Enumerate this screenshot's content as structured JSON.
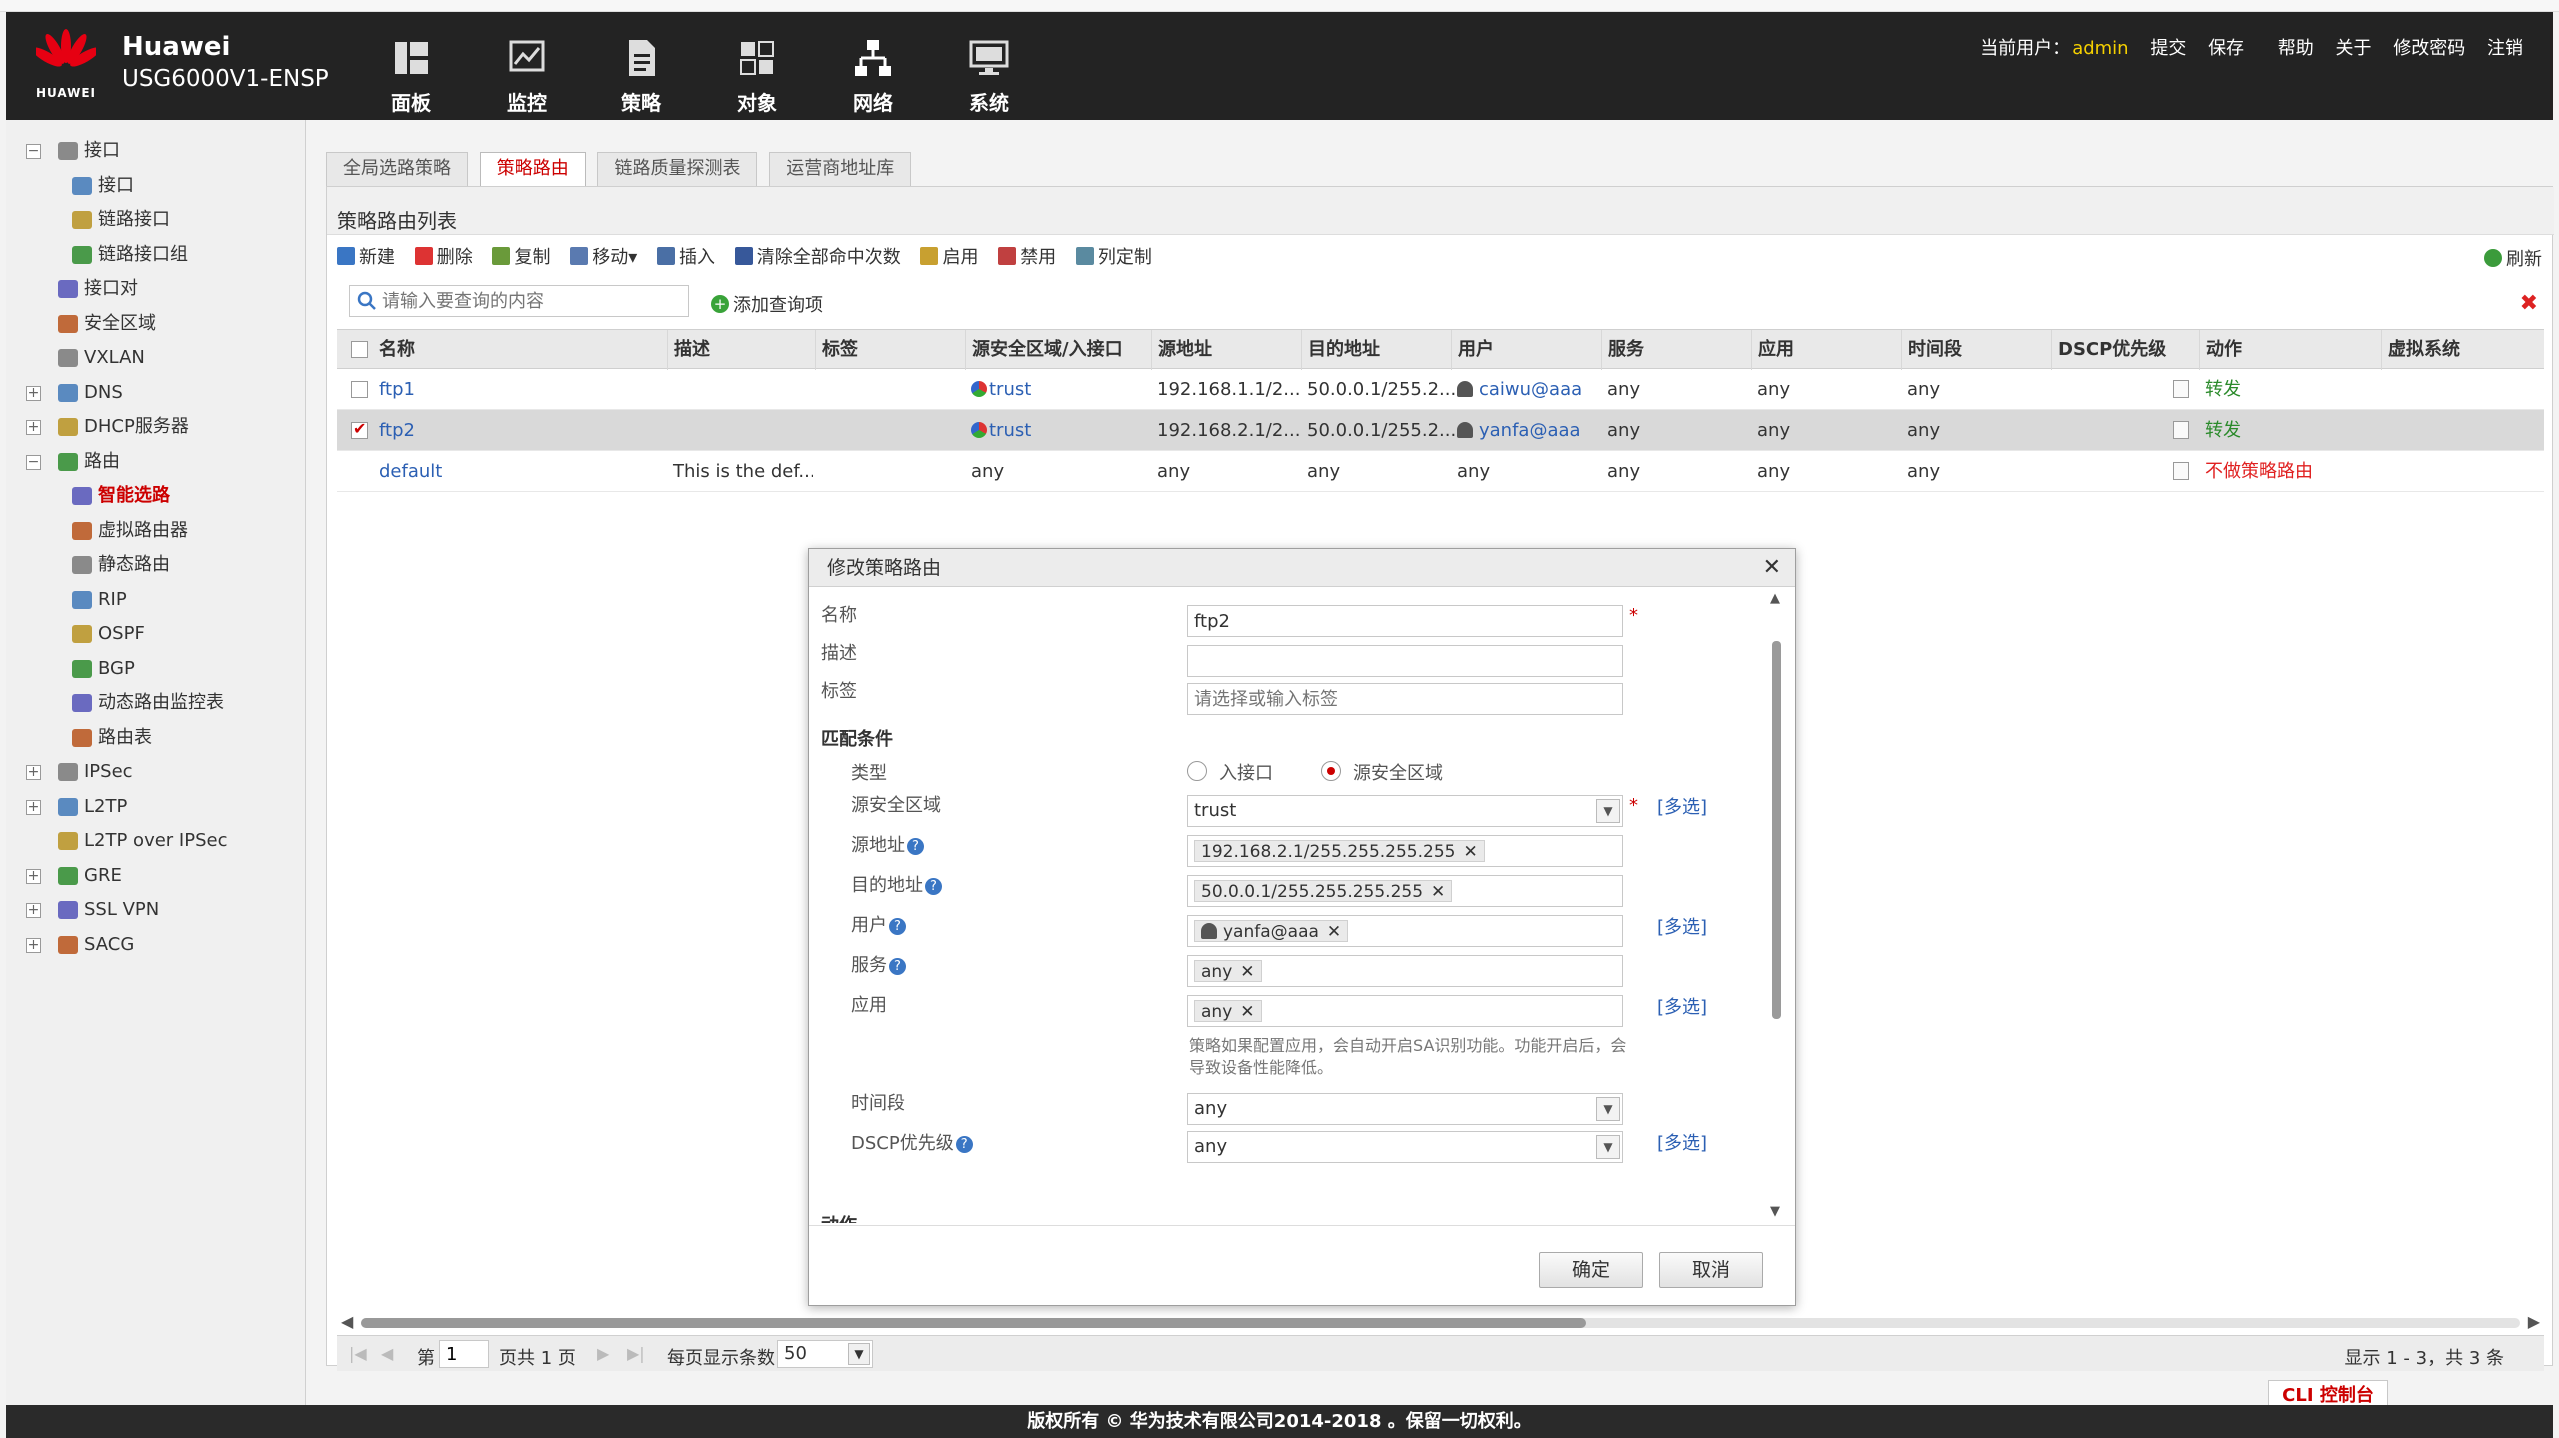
{
  "header": {
    "brand": "HUAWEI",
    "product_line1": "Huawei",
    "product_line2": "USG6000V1-ENSP",
    "nav": [
      {
        "label": "面板",
        "icon": "dashboard-icon"
      },
      {
        "label": "监控",
        "icon": "monitor-icon"
      },
      {
        "label": "策略",
        "icon": "policy-icon"
      },
      {
        "label": "对象",
        "icon": "object-icon"
      },
      {
        "label": "网络",
        "icon": "network-icon"
      },
      {
        "label": "系统",
        "icon": "system-icon"
      }
    ],
    "current_user_label": "当前用户：",
    "username": "admin",
    "links": [
      "提交",
      "保存",
      "帮助",
      "关于",
      "修改密码",
      "注销"
    ]
  },
  "sidebar": {
    "items": [
      {
        "label": "接口",
        "level": 0,
        "toggle": "−"
      },
      {
        "label": "接口",
        "level": 1
      },
      {
        "label": "链路接口",
        "level": 1
      },
      {
        "label": "链路接口组",
        "level": 1
      },
      {
        "label": "接口对",
        "level": 0
      },
      {
        "label": "安全区域",
        "level": 0
      },
      {
        "label": "VXLAN",
        "level": 0
      },
      {
        "label": "DNS",
        "level": 0,
        "toggle": "+"
      },
      {
        "label": "DHCP服务器",
        "level": 0,
        "toggle": "+"
      },
      {
        "label": "路由",
        "level": 0,
        "toggle": "−"
      },
      {
        "label": "智能选路",
        "level": 1,
        "selected": true
      },
      {
        "label": "虚拟路由器",
        "level": 1
      },
      {
        "label": "静态路由",
        "level": 1
      },
      {
        "label": "RIP",
        "level": 1
      },
      {
        "label": "OSPF",
        "level": 1
      },
      {
        "label": "BGP",
        "level": 1
      },
      {
        "label": "动态路由监控表",
        "level": 1
      },
      {
        "label": "路由表",
        "level": 1
      },
      {
        "label": "IPSec",
        "level": 0,
        "toggle": "+"
      },
      {
        "label": "L2TP",
        "level": 0,
        "toggle": "+"
      },
      {
        "label": "L2TP over IPSec",
        "level": 0
      },
      {
        "label": "GRE",
        "level": 0,
        "toggle": "+"
      },
      {
        "label": "SSL VPN",
        "level": 0,
        "toggle": "+"
      },
      {
        "label": "SACG",
        "level": 0,
        "toggle": "+"
      }
    ]
  },
  "tabs": [
    "全局选路策略",
    "策略路由",
    "链路质量探测表",
    "运营商地址库"
  ],
  "panel": {
    "title": "策略路由列表",
    "toolbar": [
      "新建",
      "删除",
      "复制",
      "移动▾",
      "插入",
      "清除全部命中次数",
      "启用",
      "禁用",
      "列定制"
    ],
    "refresh": "刷新",
    "search_placeholder": "请输入要查询的内容",
    "add_query": "添加查询项"
  },
  "table": {
    "columns": [
      "名称",
      "描述",
      "标签",
      "源安全区域/入接口",
      "源地址",
      "目的地址",
      "用户",
      "服务",
      "应用",
      "时间段",
      "DSCP优先级",
      "动作",
      "虚拟系统"
    ],
    "rows": [
      {
        "name": "ftp1",
        "desc": "",
        "tag": "",
        "zone": "trust",
        "src": "192.168.1.1/2...",
        "dst": "50.0.0.1/255.2...",
        "user": "caiwu@aaa",
        "service": "any",
        "app": "any",
        "time": "any",
        "action": "转发",
        "checked": false
      },
      {
        "name": "ftp2",
        "desc": "",
        "tag": "",
        "zone": "trust",
        "src": "192.168.2.1/2...",
        "dst": "50.0.0.1/255.2...",
        "user": "yanfa@aaa",
        "service": "any",
        "app": "any",
        "time": "any",
        "action": "转发",
        "checked": true
      },
      {
        "name": "default",
        "desc": "This is the def...",
        "tag": "",
        "zone": "any",
        "src": "any",
        "dst": "any",
        "user": "any",
        "service": "any",
        "app": "any",
        "time": "any",
        "action": "不做策略路由",
        "checked": false
      }
    ]
  },
  "pager": {
    "page_prefix": "第",
    "page": "1",
    "page_suffix": "页共 1 页",
    "per_page_label": "每页显示条数",
    "per_page": "50",
    "info": "显示 1 - 3，共 3 条"
  },
  "dialog": {
    "title": "修改策略路由",
    "name_label": "名称",
    "name_value": "ftp2",
    "desc_label": "描述",
    "desc_value": "",
    "tag_label": "标签",
    "tag_placeholder": "请选择或输入标签",
    "match_section": "匹配条件",
    "type_label": "类型",
    "type_opt1": "入接口",
    "type_opt2": "源安全区域",
    "src_zone_label": "源安全区域",
    "src_zone_value": "trust",
    "src_addr_label": "源地址",
    "src_addr_value": "192.168.2.1/255.255.255.255",
    "dst_addr_label": "目的地址",
    "dst_addr_value": "50.0.0.1/255.255.255.255",
    "user_label": "用户",
    "user_value": "yanfa@aaa",
    "service_label": "服务",
    "service_value": "any",
    "app_label": "应用",
    "app_value": "any",
    "app_note": "策略如果配置应用，会自动开启SA识别功能。功能开启后，会导致设备性能降低。",
    "time_label": "时间段",
    "time_value": "any",
    "dscp_label": "DSCP优先级",
    "dscp_value": "any",
    "action_label_partial": "动作",
    "more": "[多选]",
    "ok": "确定",
    "cancel": "取消"
  },
  "cli": "CLI 控制台",
  "footer": "版权所有 © 华为技术有限公司2014-2018 。保留一切权利。"
}
